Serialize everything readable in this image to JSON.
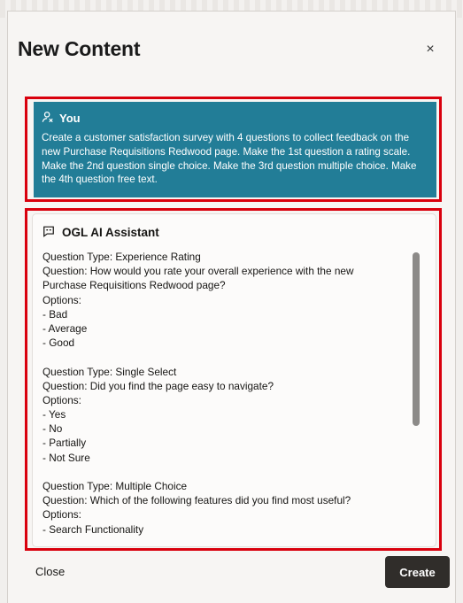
{
  "dialog": {
    "title": "New Content",
    "close_glyph": "×"
  },
  "user_message": {
    "author": "You",
    "icon": "user-icon",
    "text": "Create a customer satisfaction survey with 4 questions to collect feedback on the new Purchase Requisitions Redwood page. Make the 1st question a rating scale. Make the 2nd question single choice. Make the 3rd question multiple choice. Make the 4th question free text."
  },
  "assistant_message": {
    "author": "OGL AI Assistant",
    "icon": "chat-bubble-icon",
    "lines": [
      "Question Type: Experience Rating",
      "Question: How would you rate your overall experience with the new",
      "Purchase Requisitions Redwood page?",
      "Options:",
      "- Bad",
      "- Average",
      "- Good",
      "",
      "Question Type: Single Select",
      "Question: Did you find the page easy to navigate?",
      "Options:",
      "- Yes",
      "- No",
      "- Partially",
      "- Not Sure",
      "",
      "Question Type: Multiple Choice",
      "Question: Which of the following features did you find most useful?",
      "Options:",
      "- Search Functionality"
    ]
  },
  "footer": {
    "close_label": "Close",
    "create_label": "Create"
  },
  "colors": {
    "user_bubble": "#227d97",
    "highlight_outline": "#d9000d",
    "create_button": "#302d2a"
  }
}
